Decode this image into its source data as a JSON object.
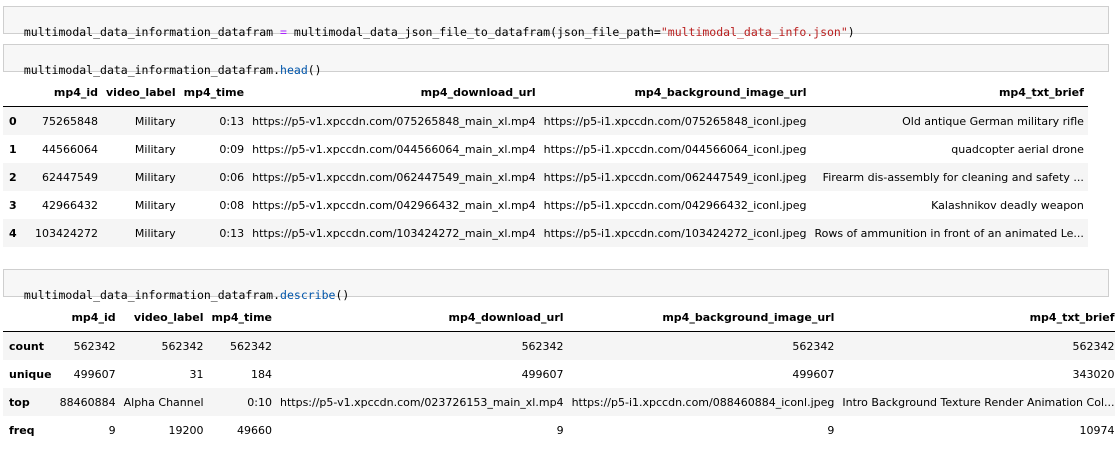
{
  "cells": [
    {
      "var": "multimodal_data_information_datafram",
      "eq": " = ",
      "func": "multimodal_data_json_file_to_datafram(json_file_path=",
      "arg": "\"multimodal_data_info.json\"",
      "close": ")"
    },
    {
      "var": "multimodal_data_information_datafram.",
      "method": "head",
      "close": "()"
    },
    {
      "var": "multimodal_data_information_datafram.",
      "method": "describe",
      "close": "()"
    }
  ],
  "head_table": {
    "columns": [
      "mp4_id",
      "video_label",
      "mp4_time",
      "mp4_download_url",
      "mp4_background_image_url",
      "mp4_txt_brief"
    ],
    "rows": [
      {
        "index": "0",
        "cells": [
          "75265848",
          "Military",
          "0:13",
          "https://p5-v1.xpccdn.com/075265848_main_xl.mp4",
          "https://p5-i1.xpccdn.com/075265848_iconl.jpeg",
          "Old antique German military rifle"
        ]
      },
      {
        "index": "1",
        "cells": [
          "44566064",
          "Military",
          "0:09",
          "https://p5-v1.xpccdn.com/044566064_main_xl.mp4",
          "https://p5-i1.xpccdn.com/044566064_iconl.jpeg",
          "quadcopter aerial drone"
        ]
      },
      {
        "index": "2",
        "cells": [
          "62447549",
          "Military",
          "0:06",
          "https://p5-v1.xpccdn.com/062447549_main_xl.mp4",
          "https://p5-i1.xpccdn.com/062447549_iconl.jpeg",
          "Firearm dis-assembly for cleaning and safety ..."
        ]
      },
      {
        "index": "3",
        "cells": [
          "42966432",
          "Military",
          "0:08",
          "https://p5-v1.xpccdn.com/042966432_main_xl.mp4",
          "https://p5-i1.xpccdn.com/042966432_iconl.jpeg",
          "Kalashnikov deadly weapon"
        ]
      },
      {
        "index": "4",
        "cells": [
          "103424272",
          "Military",
          "0:13",
          "https://p5-v1.xpccdn.com/103424272_main_xl.mp4",
          "https://p5-i1.xpccdn.com/103424272_iconl.jpeg",
          "Rows of ammunition in front of an animated Le..."
        ]
      }
    ]
  },
  "describe_table": {
    "columns": [
      "mp4_id",
      "video_label",
      "mp4_time",
      "mp4_download_url",
      "mp4_background_image_url",
      "mp4_txt_brief"
    ],
    "rows": [
      {
        "index": "count",
        "cells": [
          "562342",
          "562342",
          "562342",
          "562342",
          "562342",
          "562342"
        ]
      },
      {
        "index": "unique",
        "cells": [
          "499607",
          "31",
          "184",
          "499607",
          "499607",
          "343020"
        ]
      },
      {
        "index": "top",
        "cells": [
          "88460884",
          "Alpha Channel",
          "0:10",
          "https://p5-v1.xpccdn.com/023726153_main_xl.mp4",
          "https://p5-i1.xpccdn.com/088460884_iconl.jpeg",
          "Intro Background Texture Render Animation Col..."
        ]
      },
      {
        "index": "freq",
        "cells": [
          "9",
          "19200",
          "49660",
          "9",
          "9",
          "10974"
        ]
      }
    ]
  }
}
